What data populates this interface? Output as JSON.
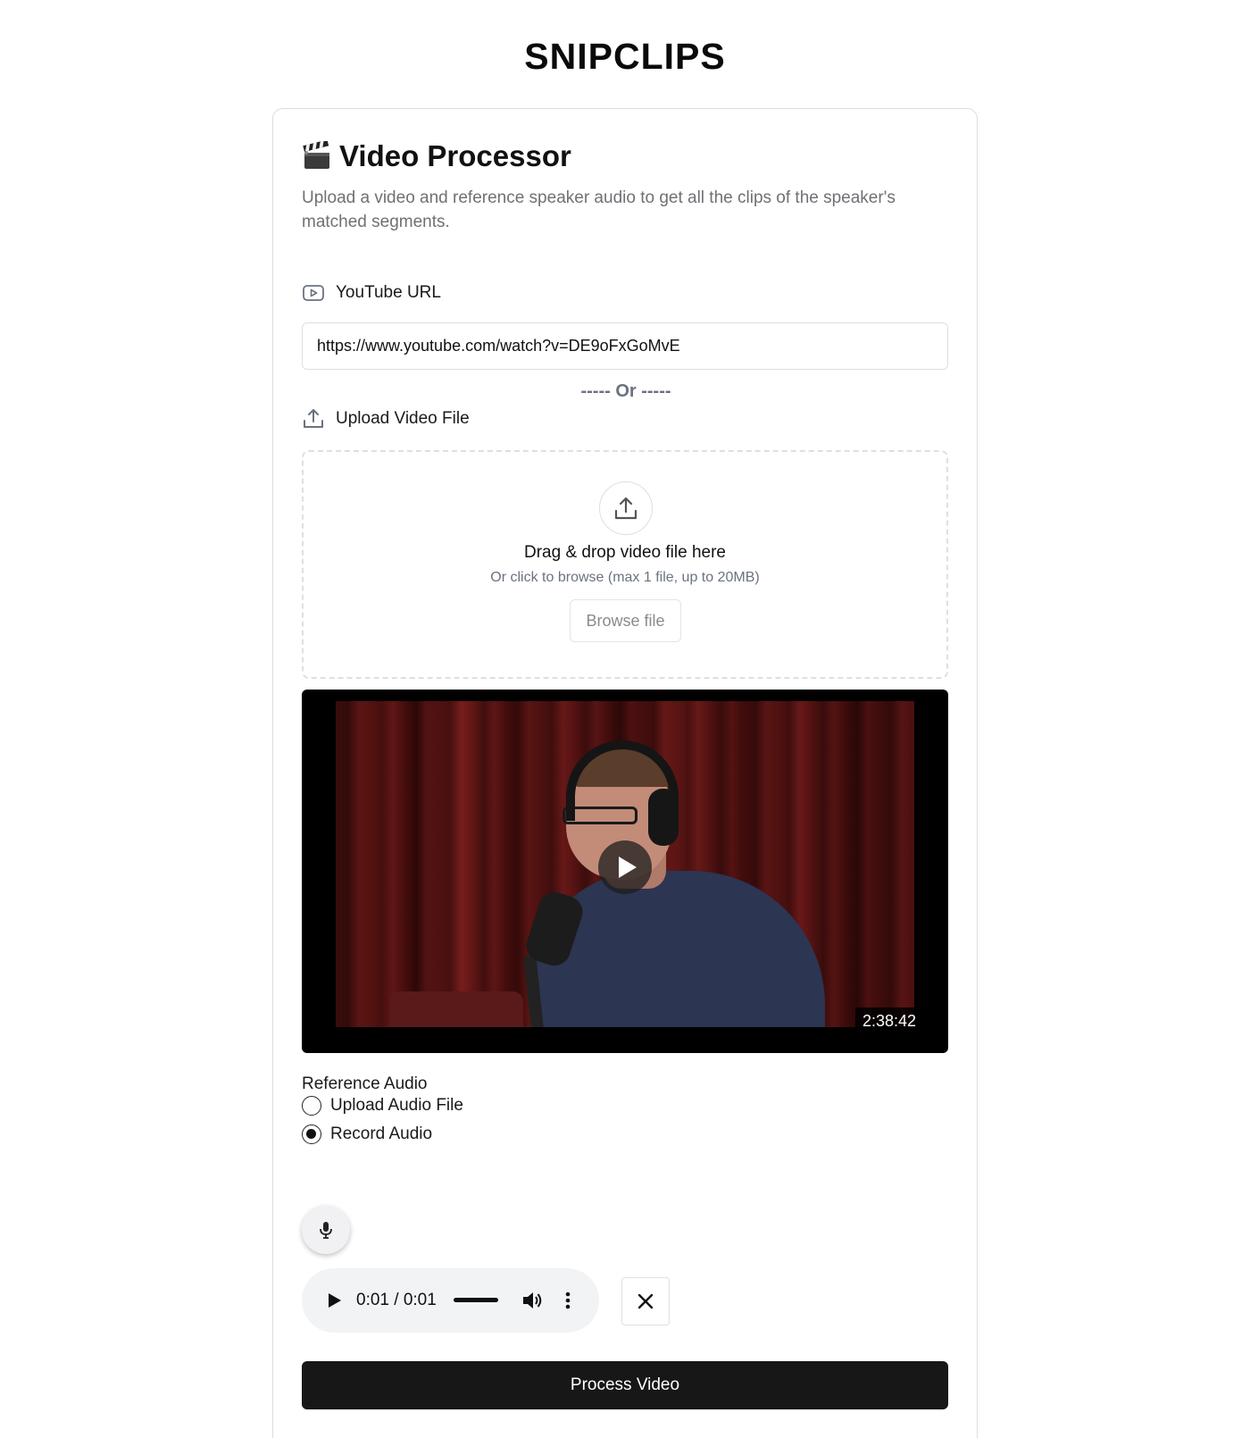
{
  "app": {
    "title": "SNIPCLIPS"
  },
  "card": {
    "heading": "Video Processor",
    "heading_icon": "clapperboard-icon",
    "description": "Upload a video and reference speaker audio to get all the clips of the speaker's matched segments."
  },
  "youtube": {
    "label": "YouTube URL",
    "icon": "youtube-icon",
    "value": "https://www.youtube.com/watch?v=DE9oFxGoMvE"
  },
  "divider": {
    "text": "----- Or -----"
  },
  "upload": {
    "label": "Upload Video File",
    "icon": "upload-icon",
    "dropzone_title": "Drag & drop video file here",
    "dropzone_subtitle": "Or click to browse (max 1 file, up to 20MB)",
    "browse_label": "Browse file"
  },
  "video": {
    "duration": "2:38:42",
    "play_icon": "play-icon"
  },
  "reference_audio": {
    "label": "Reference Audio",
    "options": [
      {
        "label": "Upload Audio File",
        "selected": false
      },
      {
        "label": "Record Audio",
        "selected": true
      }
    ]
  },
  "recorder": {
    "mic_icon": "microphone-icon",
    "time": "0:01 / 0:01",
    "progress": 1.0
  },
  "actions": {
    "clear_icon": "close-icon",
    "process_label": "Process Video"
  },
  "colors": {
    "primary_button": "#171717",
    "muted_text": "#707075",
    "border": "#dedfe3"
  }
}
